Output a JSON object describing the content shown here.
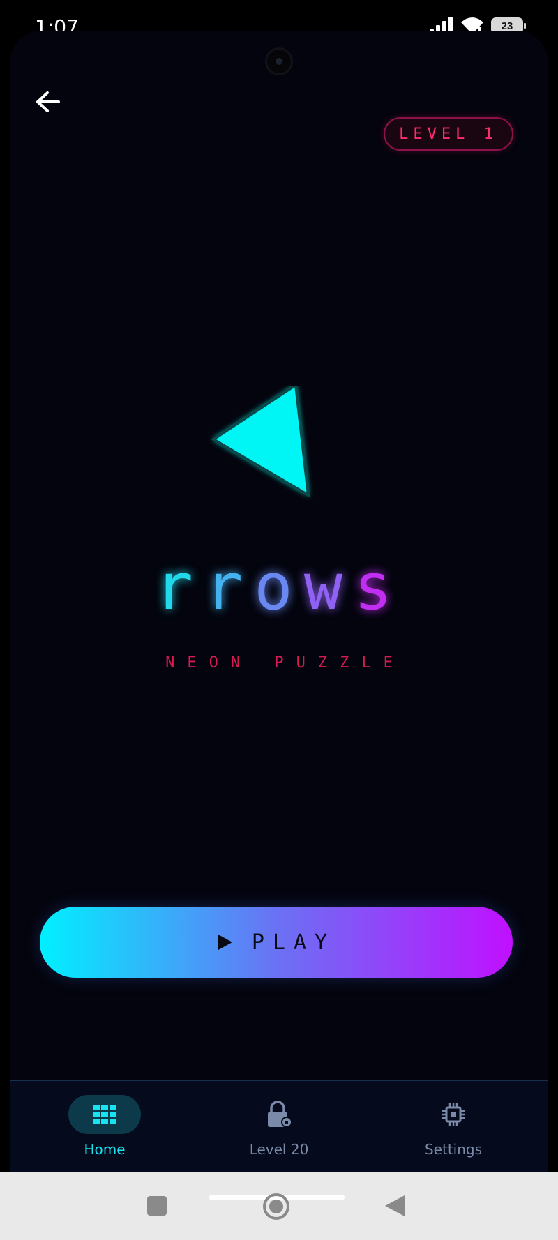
{
  "status_bar": {
    "time": "1:07",
    "battery": "23"
  },
  "header": {
    "level_badge": "LEVEL 1"
  },
  "logo": {
    "letters": [
      {
        "char": "r",
        "color": "#22d9ec"
      },
      {
        "char": "r",
        "color": "#45b2f0"
      },
      {
        "char": "o",
        "color": "#6a88f2"
      },
      {
        "char": "w",
        "color": "#8f62f4"
      },
      {
        "char": "s",
        "color": "#c02ef2"
      }
    ],
    "arrow_color": "#00f5f5",
    "tagline": "NEON PUZZLE"
  },
  "play_button": {
    "label": "PLAY"
  },
  "bottom_nav": {
    "items": [
      {
        "label": "Home",
        "icon": "grid-icon",
        "active": true
      },
      {
        "label": "Level 20",
        "icon": "lock-icon",
        "active": false
      },
      {
        "label": "Settings",
        "icon": "chip-icon",
        "active": false
      }
    ]
  },
  "colors": {
    "background": "#03040d",
    "accent_cyan": "#00f0ff",
    "accent_purple": "#c010ff",
    "accent_pink": "#ff2d6f"
  }
}
